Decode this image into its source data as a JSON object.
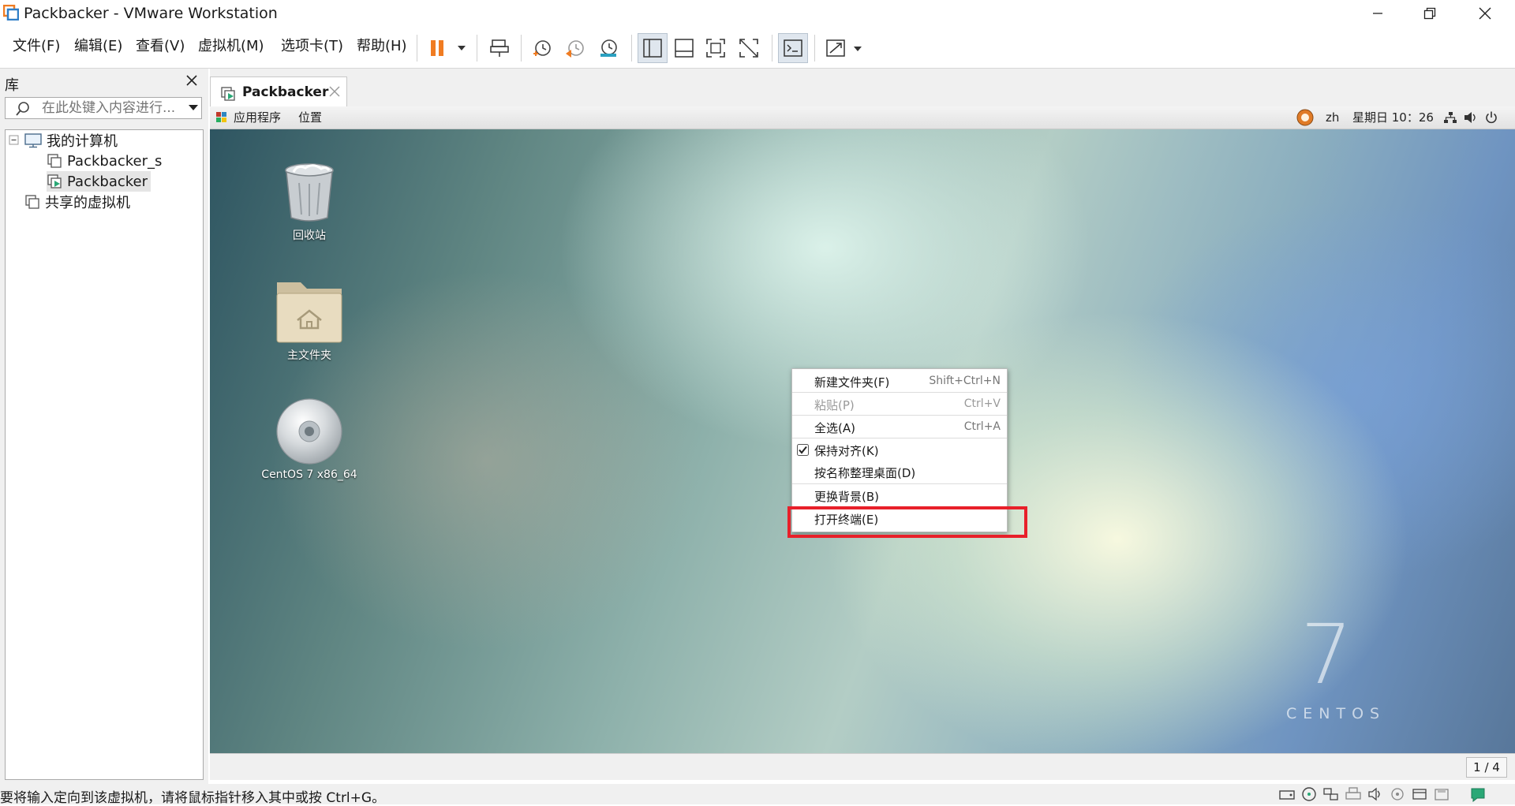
{
  "window": {
    "title": "Packbacker - VMware Workstation"
  },
  "menu": {
    "file": "文件(F)",
    "edit": "编辑(E)",
    "view": "查看(V)",
    "vm": "虚拟机(M)",
    "tabs": "选项卡(T)",
    "help": "帮助(H)"
  },
  "library": {
    "title": "库",
    "search_placeholder": "在此处键入内容进行...",
    "tree": {
      "my_computer": "我的计算机",
      "vm1": "Packbacker_s",
      "vm2": "Packbacker",
      "shared": "共享的虚拟机"
    }
  },
  "tab": {
    "label": "Packbacker"
  },
  "gnome_bar": {
    "applications": "应用程序",
    "places": "位置",
    "lang": "zh",
    "clock": "星期日 10：26"
  },
  "desktop": {
    "icons": [
      {
        "label": "回收站",
        "icon": "trash-icon"
      },
      {
        "label": "主文件夹",
        "icon": "home-folder-icon"
      },
      {
        "label": "CentOS 7 x86_64",
        "icon": "cd-icon"
      }
    ],
    "branding_number": "7",
    "branding_word": "CENTOS"
  },
  "context_menu": {
    "items": [
      {
        "label": "新建文件夹(F)",
        "shortcut": "Shift+Ctrl+N",
        "enabled": true
      },
      {
        "label": "粘贴(P)",
        "shortcut": "Ctrl+V",
        "enabled": false
      },
      {
        "label": "全选(A)",
        "shortcut": "Ctrl+A",
        "enabled": true
      },
      {
        "label": "保持对齐(K)",
        "shortcut": "",
        "enabled": true,
        "checked": true
      },
      {
        "label": "按名称整理桌面(D)",
        "shortcut": "",
        "enabled": true
      },
      {
        "label": "更换背景(B)",
        "shortcut": "",
        "enabled": true
      },
      {
        "label": "打开终端(E)",
        "shortcut": "",
        "enabled": true
      }
    ],
    "highlight_color": "#e8202a"
  },
  "vm_bottom": {
    "page_indicator": "1 / 4"
  },
  "statusbar": {
    "text": "要将输入定向到该虚拟机，请将鼠标指针移入其中或按 Ctrl+G。"
  },
  "colors": {
    "pause_orange": "#f07c22",
    "accent_green": "#2aa876"
  }
}
